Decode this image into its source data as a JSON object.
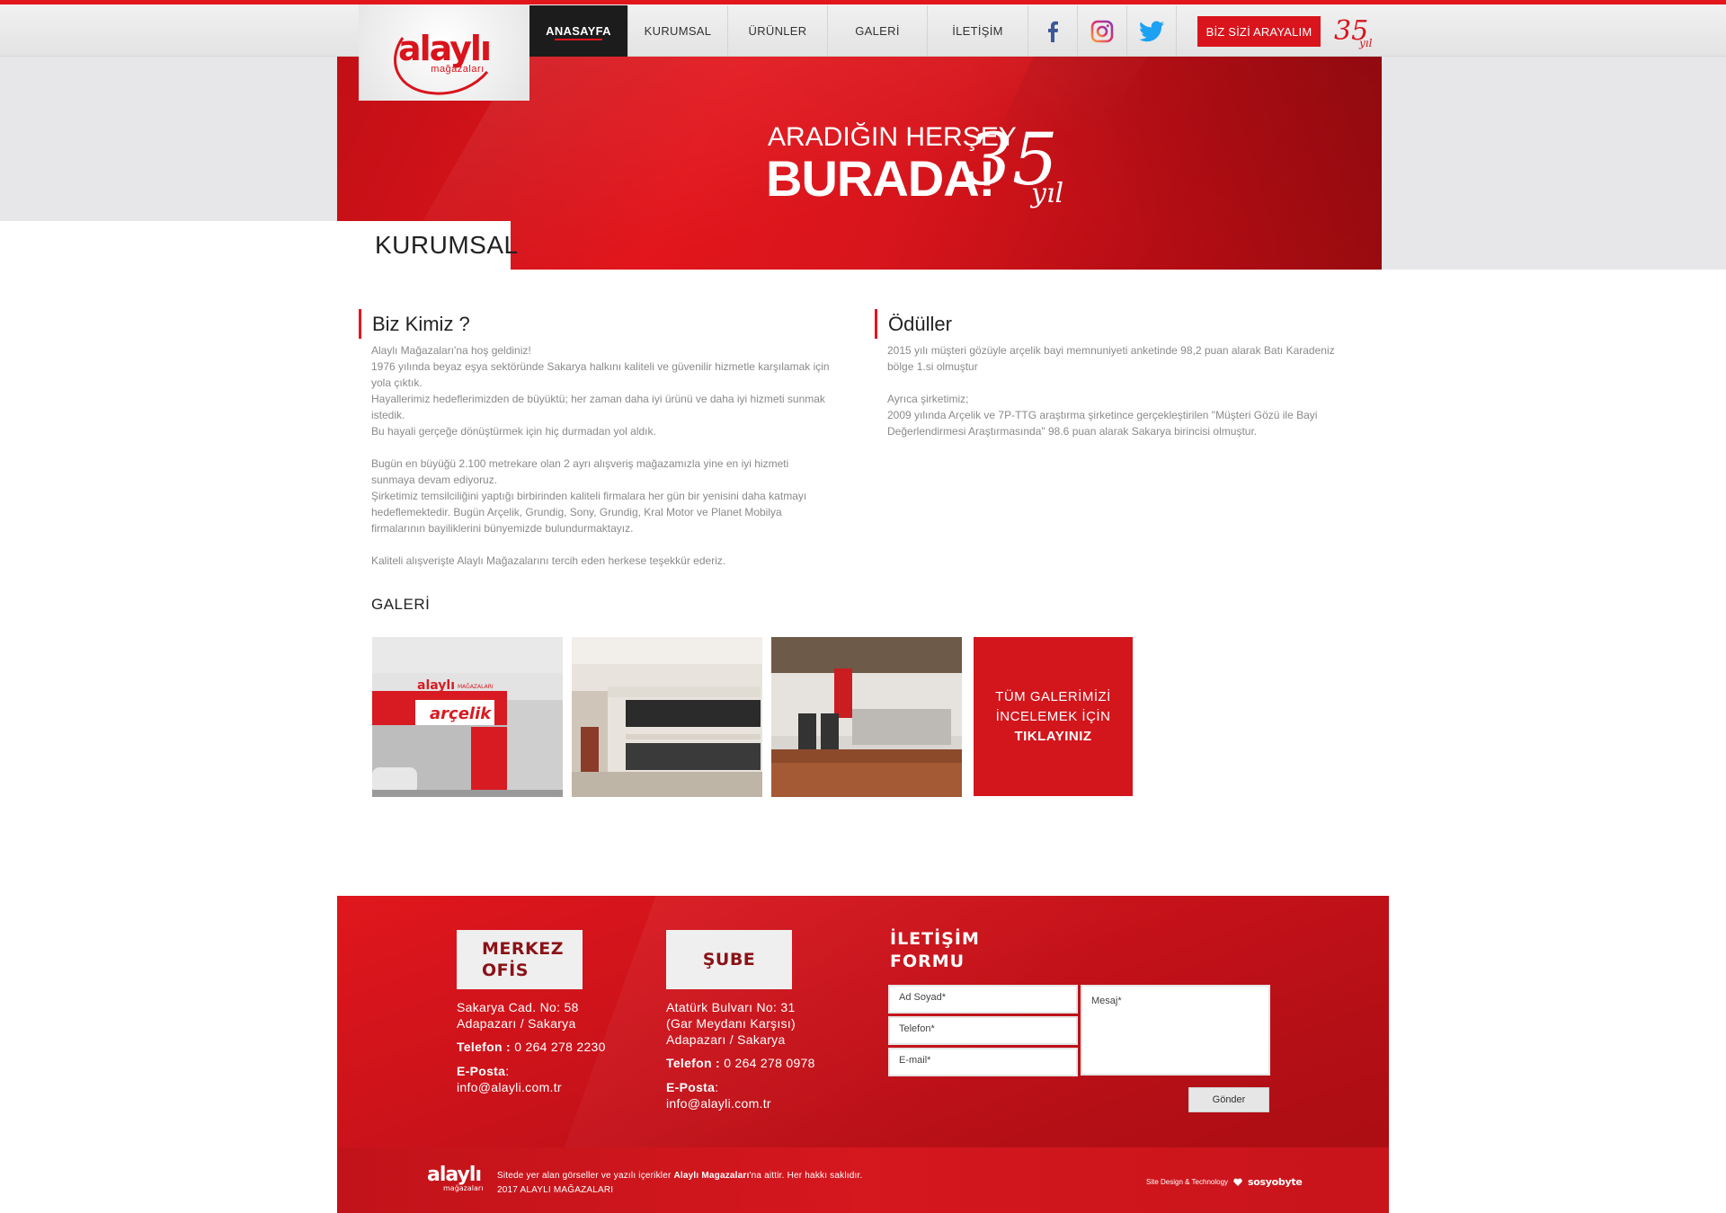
{
  "brand": {
    "logo_text": "alaylı",
    "logo_sub": "mağazaları",
    "anniversary": "35",
    "anniversary_word": "yıl",
    "accent": "#e3161d"
  },
  "nav": {
    "items": [
      {
        "label": "ANASAYFA",
        "active": true
      },
      {
        "label": "KURUMSAL",
        "active": false
      },
      {
        "label": "ÜRÜNLER",
        "active": false
      },
      {
        "label": "GALERİ",
        "active": false
      },
      {
        "label": "İLETİŞİM",
        "active": false
      }
    ],
    "social": [
      "facebook-icon",
      "instagram-icon",
      "twitter-icon"
    ],
    "call_button": "BİZ SİZİ ARAYALIM"
  },
  "hero": {
    "line1": "ARADIĞIN HERŞEY",
    "line2": "BURADA!",
    "anniversary": "35",
    "anniversary_word": "yıl"
  },
  "section": {
    "title": "KURUMSAL"
  },
  "about": {
    "title": "Biz Kimiz ?",
    "text": "Alaylı Mağazaları'na hoş geldiniz!\n1976 yılında beyaz eşya sektöründe Sakarya halkını kaliteli ve güvenilir hizmetle karşılamak için\nyola çıktık.\nHayallerimiz hedeflerimizden de büyüktü; her zaman daha iyi ürünü ve daha iyi hizmeti sunmak\nistedik.\nBu hayali gerçeğe dönüştürmek için hiç durmadan yol aldık.\n\nBugün en büyüğü 2.100 metrekare olan 2 ayrı alışveriş mağazamızla yine en iyi hizmeti\nsunmaya devam ediyoruz.\nŞirketimiz temsilciliğini yaptığı birbirinden kaliteli firmalara her gün bir yenisini daha katmayı\nhedeflemektedir. Bugün Arçelik, Grundig, Sony, Grundig, Kral Motor ve Planet Mobilya\nfirmalarının bayiliklerini bünyemizde bulundurmaktayız.\n\nKaliteli alışverişte Alaylı Mağazalarını tercih eden herkese teşekkür ederiz."
  },
  "awards": {
    "title": "Ödüller",
    "text": "2015 yılı müşteri gözüyle arçelik bayi memnuniyeti anketinde 98,2 puan alarak Batı Karadeniz\nbölge 1.si olmuştur\n\nAyrıca şirketimiz;\n2009 yılında Arçelik ve 7P-TTG araştırma şirketince gerçekleştirilen \"Müşteri Gözü ile Bayi\nDeğerlendirmesi Araştırmasında\" 98.6 puan alarak Sakarya birincisi olmuştur."
  },
  "gallery": {
    "title": "GALERİ",
    "store_sign": "alaylı",
    "store_sign_sub": "MAĞAZALARI",
    "store_brand": "arçelik",
    "cta_line1": "TÜM GALERİMİZİ",
    "cta_line2": "İNCELEMEK İÇİN",
    "cta_line3": "TIKLAYINIZ"
  },
  "footer": {
    "office": {
      "title": "MERKEZ\nOFİS",
      "address": "Sakarya Cad. No: 58\nAdapazarı / Sakarya",
      "phone_label": "Telefon :",
      "phone": "0 264 278 2230",
      "email_label": "E-Posta",
      "email": "info@alayli.com.tr"
    },
    "branch": {
      "title": "ŞUBE",
      "address": "Atatürk Bulvarı No: 31\n(Gar Meydanı Karşısı)\nAdapazarı / Sakarya",
      "phone_label": "Telefon :",
      "phone": "0 264 278 0978",
      "email_label": "E-Posta",
      "email": "info@alayli.com.tr"
    },
    "form": {
      "title": "İLETİŞİM\nFORMU",
      "name": "Ad Soyad*",
      "phone": "Telefon*",
      "email": "E-mail*",
      "message": "Mesaj*",
      "send": "Gönder"
    },
    "copyright_pre": "Sitede yer alan görseller ve yazılı içerikler ",
    "copyright_brand": "Alaylı Magazaları",
    "copyright_post": "'na aittir. Her hakkı saklıdır.",
    "copyright_year": "2017  ALAYLI MAĞAZALARI",
    "credit": "Site Design & Technology",
    "credit_brand": "sosyobyte"
  }
}
